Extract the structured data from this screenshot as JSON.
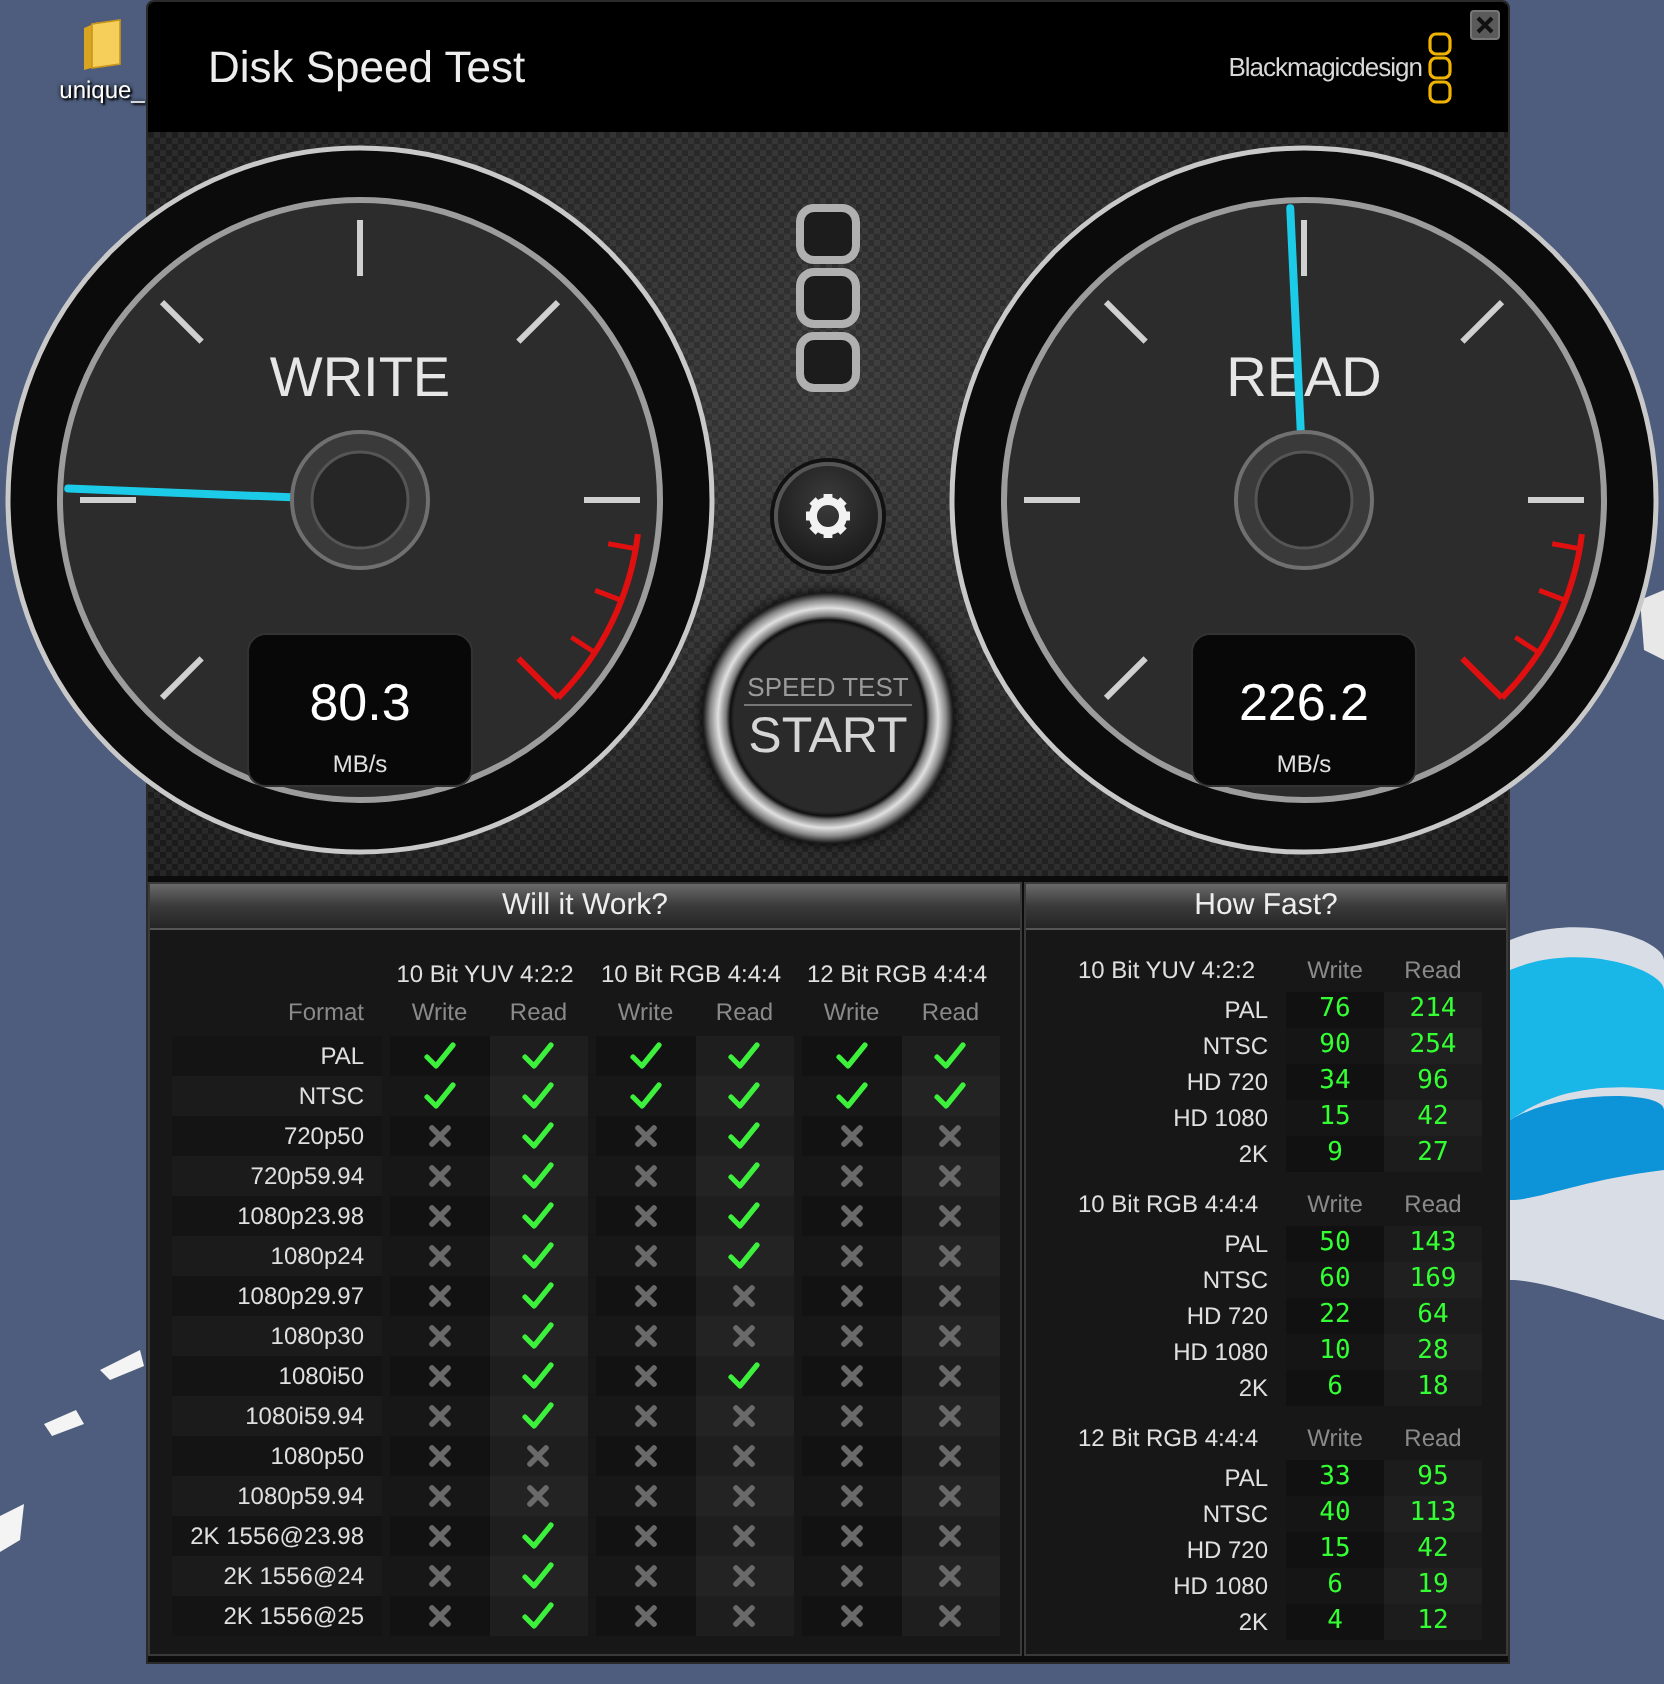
{
  "desktop": {
    "icons": [
      {
        "label": "unique_"
      }
    ]
  },
  "window": {
    "title": "Disk Speed Test",
    "brand": "Blackmagicdesign"
  },
  "gauges": [
    {
      "label": "WRITE",
      "reading": "80.3",
      "unit": "MB/s",
      "level": 0.175
    },
    {
      "label": "READ",
      "reading": "226.2",
      "unit": "MB/s",
      "level": 0.49
    }
  ],
  "start_button": {
    "caption": "SPEED TEST",
    "label": "START"
  },
  "will_it_work": {
    "title": "Will it Work?",
    "format_heading": "Format",
    "groups": [
      {
        "name": "10 Bit YUV 4:2:2",
        "columns": [
          "Write",
          "Read"
        ]
      },
      {
        "name": "10 Bit RGB 4:4:4",
        "columns": [
          "Write",
          "Read"
        ]
      },
      {
        "name": "12 Bit RGB 4:4:4",
        "columns": [
          "Write",
          "Read"
        ]
      }
    ],
    "rows": [
      {
        "format": "PAL",
        "results": [
          true,
          true,
          true,
          true,
          true,
          true
        ]
      },
      {
        "format": "NTSC",
        "results": [
          true,
          true,
          true,
          true,
          true,
          true
        ]
      },
      {
        "format": "720p50",
        "results": [
          false,
          true,
          false,
          true,
          false,
          false
        ]
      },
      {
        "format": "720p59.94",
        "results": [
          false,
          true,
          false,
          true,
          false,
          false
        ]
      },
      {
        "format": "1080p23.98",
        "results": [
          false,
          true,
          false,
          true,
          false,
          false
        ]
      },
      {
        "format": "1080p24",
        "results": [
          false,
          true,
          false,
          true,
          false,
          false
        ]
      },
      {
        "format": "1080p29.97",
        "results": [
          false,
          true,
          false,
          false,
          false,
          false
        ]
      },
      {
        "format": "1080p30",
        "results": [
          false,
          true,
          false,
          false,
          false,
          false
        ]
      },
      {
        "format": "1080i50",
        "results": [
          false,
          true,
          false,
          true,
          false,
          false
        ]
      },
      {
        "format": "1080i59.94",
        "results": [
          false,
          true,
          false,
          false,
          false,
          false
        ]
      },
      {
        "format": "1080p50",
        "results": [
          false,
          false,
          false,
          false,
          false,
          false
        ]
      },
      {
        "format": "1080p59.94",
        "results": [
          false,
          false,
          false,
          false,
          false,
          false
        ]
      },
      {
        "format": "2K 1556@23.98",
        "results": [
          false,
          true,
          false,
          false,
          false,
          false
        ]
      },
      {
        "format": "2K 1556@24",
        "results": [
          false,
          true,
          false,
          false,
          false,
          false
        ]
      },
      {
        "format": "2K 1556@25",
        "results": [
          false,
          true,
          false,
          false,
          false,
          false
        ]
      }
    ]
  },
  "how_fast": {
    "title": "How Fast?",
    "sections": [
      {
        "name": "10 Bit YUV 4:2:2",
        "columns": [
          "Write",
          "Read"
        ],
        "rows": [
          {
            "format": "PAL",
            "write": "76",
            "read": "214"
          },
          {
            "format": "NTSC",
            "write": "90",
            "read": "254"
          },
          {
            "format": "HD 720",
            "write": "34",
            "read": "96"
          },
          {
            "format": "HD 1080",
            "write": "15",
            "read": "42"
          },
          {
            "format": "2K",
            "write": "9",
            "read": "27"
          }
        ]
      },
      {
        "name": "10 Bit RGB 4:4:4",
        "columns": [
          "Write",
          "Read"
        ],
        "rows": [
          {
            "format": "PAL",
            "write": "50",
            "read": "143"
          },
          {
            "format": "NTSC",
            "write": "60",
            "read": "169"
          },
          {
            "format": "HD 720",
            "write": "22",
            "read": "64"
          },
          {
            "format": "HD 1080",
            "write": "10",
            "read": "28"
          },
          {
            "format": "2K",
            "write": "6",
            "read": "18"
          }
        ]
      },
      {
        "name": "12 Bit RGB 4:4:4",
        "columns": [
          "Write",
          "Read"
        ],
        "rows": [
          {
            "format": "PAL",
            "write": "33",
            "read": "95"
          },
          {
            "format": "NTSC",
            "write": "40",
            "read": "113"
          },
          {
            "format": "HD 720",
            "write": "15",
            "read": "42"
          },
          {
            "format": "HD 1080",
            "write": "6",
            "read": "19"
          },
          {
            "format": "2K",
            "write": "4",
            "read": "12"
          }
        ]
      }
    ]
  }
}
